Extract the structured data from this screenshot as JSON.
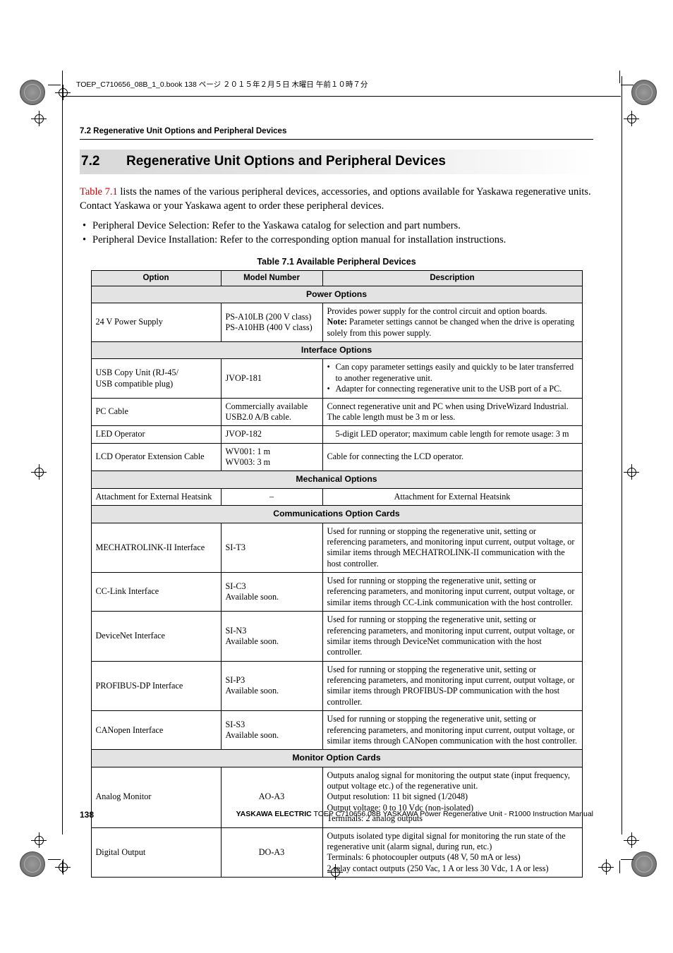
{
  "book_header": "TOEP_C710656_08B_1_0.book  138 ページ  ２０１５年２月５日  木曜日  午前１０時７分",
  "running_head": "7.2  Regenerative Unit Options and Peripheral Devices",
  "section": {
    "number": "7.2",
    "title": "Regenerative Unit Options and Peripheral Devices"
  },
  "intro": {
    "xref": "Table 7.1",
    "text": " lists the names of the various peripheral devices, accessories, and options available for Yaskawa regenerative units. Contact Yaskawa or your Yaskawa agent to order these peripheral devices."
  },
  "bullets": [
    "Peripheral Device Selection: Refer to the Yaskawa catalog for selection and part numbers.",
    "Peripheral Device Installation: Refer to the corresponding option manual for installation instructions."
  ],
  "table": {
    "caption": "Table 7.1  Available Peripheral Devices",
    "headers": [
      "Option",
      "Model Number",
      "Description"
    ],
    "groups": [
      {
        "name": "Power Options",
        "rows": [
          {
            "option": "24 V Power Supply",
            "model": "PS-A10LB (200 V class)\nPS-A10HB (400 V class)",
            "description_pre": "Provides power supply for the control circuit and option boards.",
            "description_bold": "Note:",
            "description_post": " Parameter settings cannot be changed when the drive is operating solely from this power supply."
          }
        ]
      },
      {
        "name": "Interface Options",
        "rows": [
          {
            "option": "USB Copy Unit (RJ-45/\nUSB compatible plug)",
            "model": "JVOP-181",
            "desc_bullets": [
              "Can copy parameter settings easily and quickly to be later transferred to another regenerative unit.",
              "Adapter for connecting regenerative unit to the USB port of a PC."
            ]
          },
          {
            "option": "PC Cable",
            "model": "Commercially available\nUSB2.0 A/B cable.",
            "description": "Connect regenerative unit and PC when using DriveWizard Industrial.\nThe cable length must be 3 m or less."
          },
          {
            "option": "LED Operator",
            "model": "JVOP-182",
            "description": "5-digit LED operator; maximum cable length for remote usage: 3 m",
            "desc_center": true
          },
          {
            "option": "LCD Operator Extension Cable",
            "model": "WV001: 1 m\nWV003: 3 m",
            "description": "Cable for connecting the LCD operator."
          }
        ]
      },
      {
        "name": "Mechanical Options",
        "rows": [
          {
            "option": "Attachment for External Heatsink",
            "model": "–",
            "model_center": true,
            "description": "Attachment for External Heatsink",
            "desc_center": true
          }
        ]
      },
      {
        "name": "Communications Option Cards",
        "rows": [
          {
            "option": "MECHATROLINK-II Interface",
            "model": "SI-T3",
            "description": "Used for running or stopping the regenerative unit, setting or referencing parameters, and monitoring input current, output voltage, or similar items through MECHATROLINK-II communication with the host controller."
          },
          {
            "option": "CC-Link Interface",
            "model": "SI-C3\nAvailable soon.",
            "description": "Used for running or stopping the regenerative unit, setting or referencing parameters, and monitoring input current, output voltage, or similar items through CC-Link communication with the host controller."
          },
          {
            "option": "DeviceNet Interface",
            "model": "SI-N3\nAvailable soon.",
            "description": "Used for running or stopping the regenerative unit, setting or referencing parameters, and monitoring input current, output voltage, or similar items through DeviceNet communication with the host controller."
          },
          {
            "option": "PROFIBUS-DP Interface",
            "model": "SI-P3\nAvailable soon.",
            "description": "Used for running or stopping the regenerative unit, setting or referencing parameters, and monitoring input current, output voltage, or similar items through PROFIBUS-DP communication with the host controller."
          },
          {
            "option": "CANopen Interface",
            "model": "SI-S3\nAvailable soon.",
            "description": "Used for running or stopping the regenerative unit, setting or referencing parameters, and monitoring input current, output voltage, or similar items through CANopen communication with the host controller."
          }
        ]
      },
      {
        "name": "Monitor Option Cards",
        "rows": [
          {
            "option": "Analog Monitor",
            "model": "AO-A3",
            "model_center": true,
            "description": "Outputs analog signal for monitoring the output state (input frequency, output voltage etc.) of the regenerative unit.\nOutput resolution: 11 bit signed (1/2048)\nOutput voltage: 0 to 10 Vdc (non-isolated)\nTerminals: 2 analog outputs"
          },
          {
            "option": "Digital Output",
            "model": "DO-A3",
            "model_center": true,
            "description": "Outputs isolated type digital signal for monitoring the run state of the regenerative unit (alarm signal, during run, etc.)\nTerminals: 6 photocoupler outputs (48 V, 50 mA or less)\n2 relay contact outputs (250 Vac, 1 A or less 30 Vdc, 1 A or less)"
          }
        ]
      }
    ]
  },
  "footer": {
    "page_number": "138",
    "brand": "YASKAWA ELECTRIC",
    "text": " TOEP C710656 08B YASKAWA Power Regenerative Unit - R1000 Instruction Manual"
  }
}
